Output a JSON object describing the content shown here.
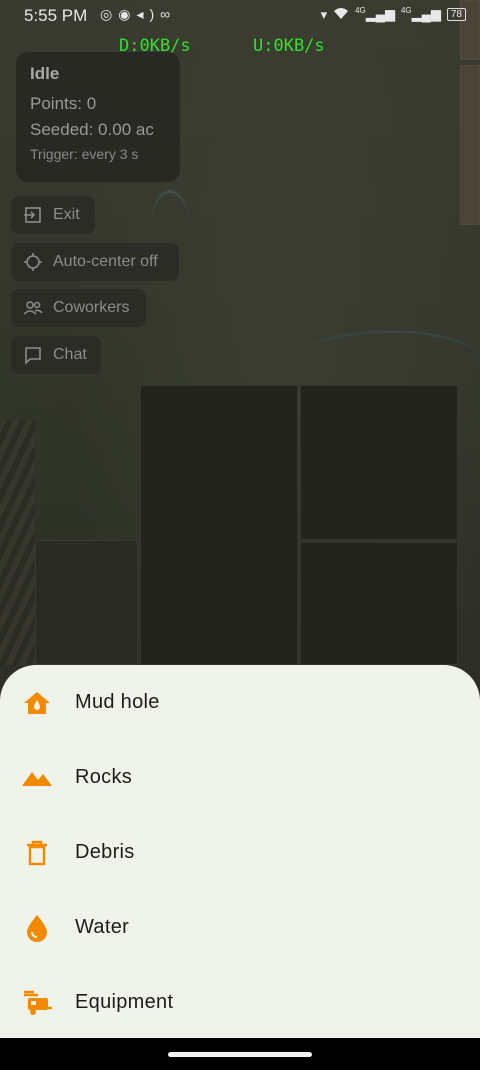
{
  "status_bar": {
    "time": "5:55 PM",
    "left_icons": [
      "whatsapp-icon",
      "status-icon",
      "volume-icon",
      "link-icon"
    ],
    "right_icons": [
      "vibrate-icon",
      "wifi-icon",
      "signal-4g-icon",
      "signal-4g-icon"
    ],
    "network_1": "4G",
    "network_2": "4G",
    "battery": "78"
  },
  "net_speed": {
    "download": "D:0KB/s",
    "upload": "U:0KB/s"
  },
  "info_panel": {
    "state": "Idle",
    "points": "Points: 0",
    "seeded": "Seeded: 0.00 ac",
    "trigger": "Trigger: every 3 s"
  },
  "map_buttons": [
    {
      "label": "Exit",
      "icon": "exit-icon"
    },
    {
      "label": "Auto-center off",
      "icon": "crosshair-icon"
    },
    {
      "label": "Coworkers",
      "icon": "people-icon"
    },
    {
      "label": "Chat",
      "icon": "chat-icon"
    }
  ],
  "sheet_items": [
    {
      "label": "Mud hole",
      "icon": "house-drop-icon"
    },
    {
      "label": "Rocks",
      "icon": "mountains-icon"
    },
    {
      "label": "Debris",
      "icon": "trash-icon"
    },
    {
      "label": "Water",
      "icon": "water-drop-icon"
    },
    {
      "label": "Equipment",
      "icon": "rv-equipment-icon"
    }
  ],
  "colors": {
    "accent": "#f28a00",
    "sheet_bg": "#f0f3ea",
    "net_speed": "#2fe02f"
  }
}
